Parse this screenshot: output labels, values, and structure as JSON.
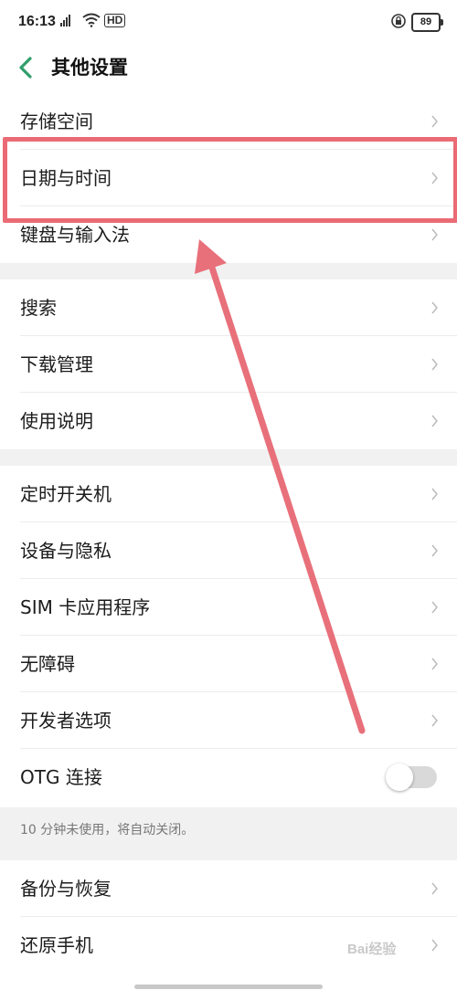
{
  "status_bar": {
    "time": "16:13",
    "network": "HD",
    "battery": "89"
  },
  "header": {
    "title": "其他设置"
  },
  "rows": [
    {
      "label": "存储空间"
    },
    {
      "label": "日期与时间"
    },
    {
      "label": "键盘与输入法"
    },
    {
      "label": "搜索"
    },
    {
      "label": "下载管理"
    },
    {
      "label": "使用说明"
    },
    {
      "label": "定时开关机"
    },
    {
      "label": "设备与隐私"
    },
    {
      "label": "SIM 卡应用程序"
    },
    {
      "label": "无障碍"
    },
    {
      "label": "开发者选项"
    },
    {
      "label": "OTG 连接",
      "toggle": false
    },
    {
      "label": "备份与恢复"
    },
    {
      "label": "还原手机"
    }
  ],
  "otg_hint": "10 分钟未使用，将自动关闭。",
  "watermark": "Bai经验",
  "colors": {
    "accent": "#2f9e6b",
    "highlight": "#ea6b74"
  }
}
